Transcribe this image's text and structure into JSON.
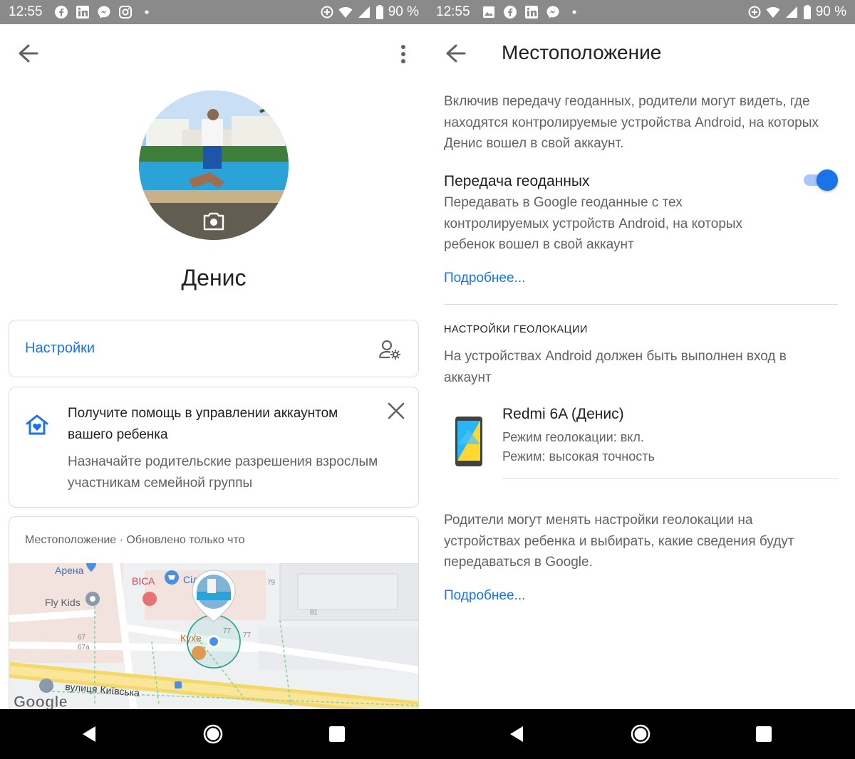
{
  "status_left": {
    "time": "12:55",
    "battery": "90 %"
  },
  "status_right": {
    "time": "12:55",
    "battery": "90 %"
  },
  "profile": {
    "name": "Денис"
  },
  "settings_card": {
    "label": "Настройки"
  },
  "help_card": {
    "title": "Получите помощь в управлении аккаунтом вашего ребенка",
    "body": "Назначайте родительские разрешения взрослым участникам семейной группы"
  },
  "map_card": {
    "header": "Местоположение · Обновлено только что",
    "labels": {
      "arena": "Арена",
      "vesa": "ВІСА",
      "silpo": "Сіль",
      "fly_kids": "Fly Kids",
      "kuhnya": "Кухе",
      "street": "вулиця Київська",
      "n79": "79",
      "n81": "81",
      "n77a": "77",
      "n77b": "77",
      "n67": "67",
      "n67a": "67а",
      "google": "Google"
    }
  },
  "location": {
    "title": "Местоположение",
    "intro": "Включив передачу геоданных, родители могут видеть, где находятся контролируемые устройства Android, на которых Денис вошел в свой аккаунт.",
    "sharing_title": "Передача геоданных",
    "sharing_desc": "Передавать в Google геоданные с тех контролируемых устройств Android, на которых ребенок вошел в свой аккаунт",
    "sharing_enabled": true,
    "more_link_1": "Подробнее...",
    "section_header": "НАСТРОЙКИ ГЕОЛОКАЦИИ",
    "section_desc": "На устройствах Android должен быть выполнен вход в аккаунт",
    "device": {
      "name": "Redmi 6A (Денис)",
      "geo_mode": "Режим геолокации: вкл.",
      "accuracy": "Режим: высокая точность"
    },
    "parents_note": "Родители могут менять настройки геолокации на устройствах ребенка и выбирать, какие сведения будут передаваться в Google.",
    "more_link_2": "Подробнее..."
  },
  "colors": {
    "accent": "#1a73e8",
    "status_bar": "#8a8a8a",
    "text_primary": "#202124",
    "text_secondary": "#5f6368"
  }
}
